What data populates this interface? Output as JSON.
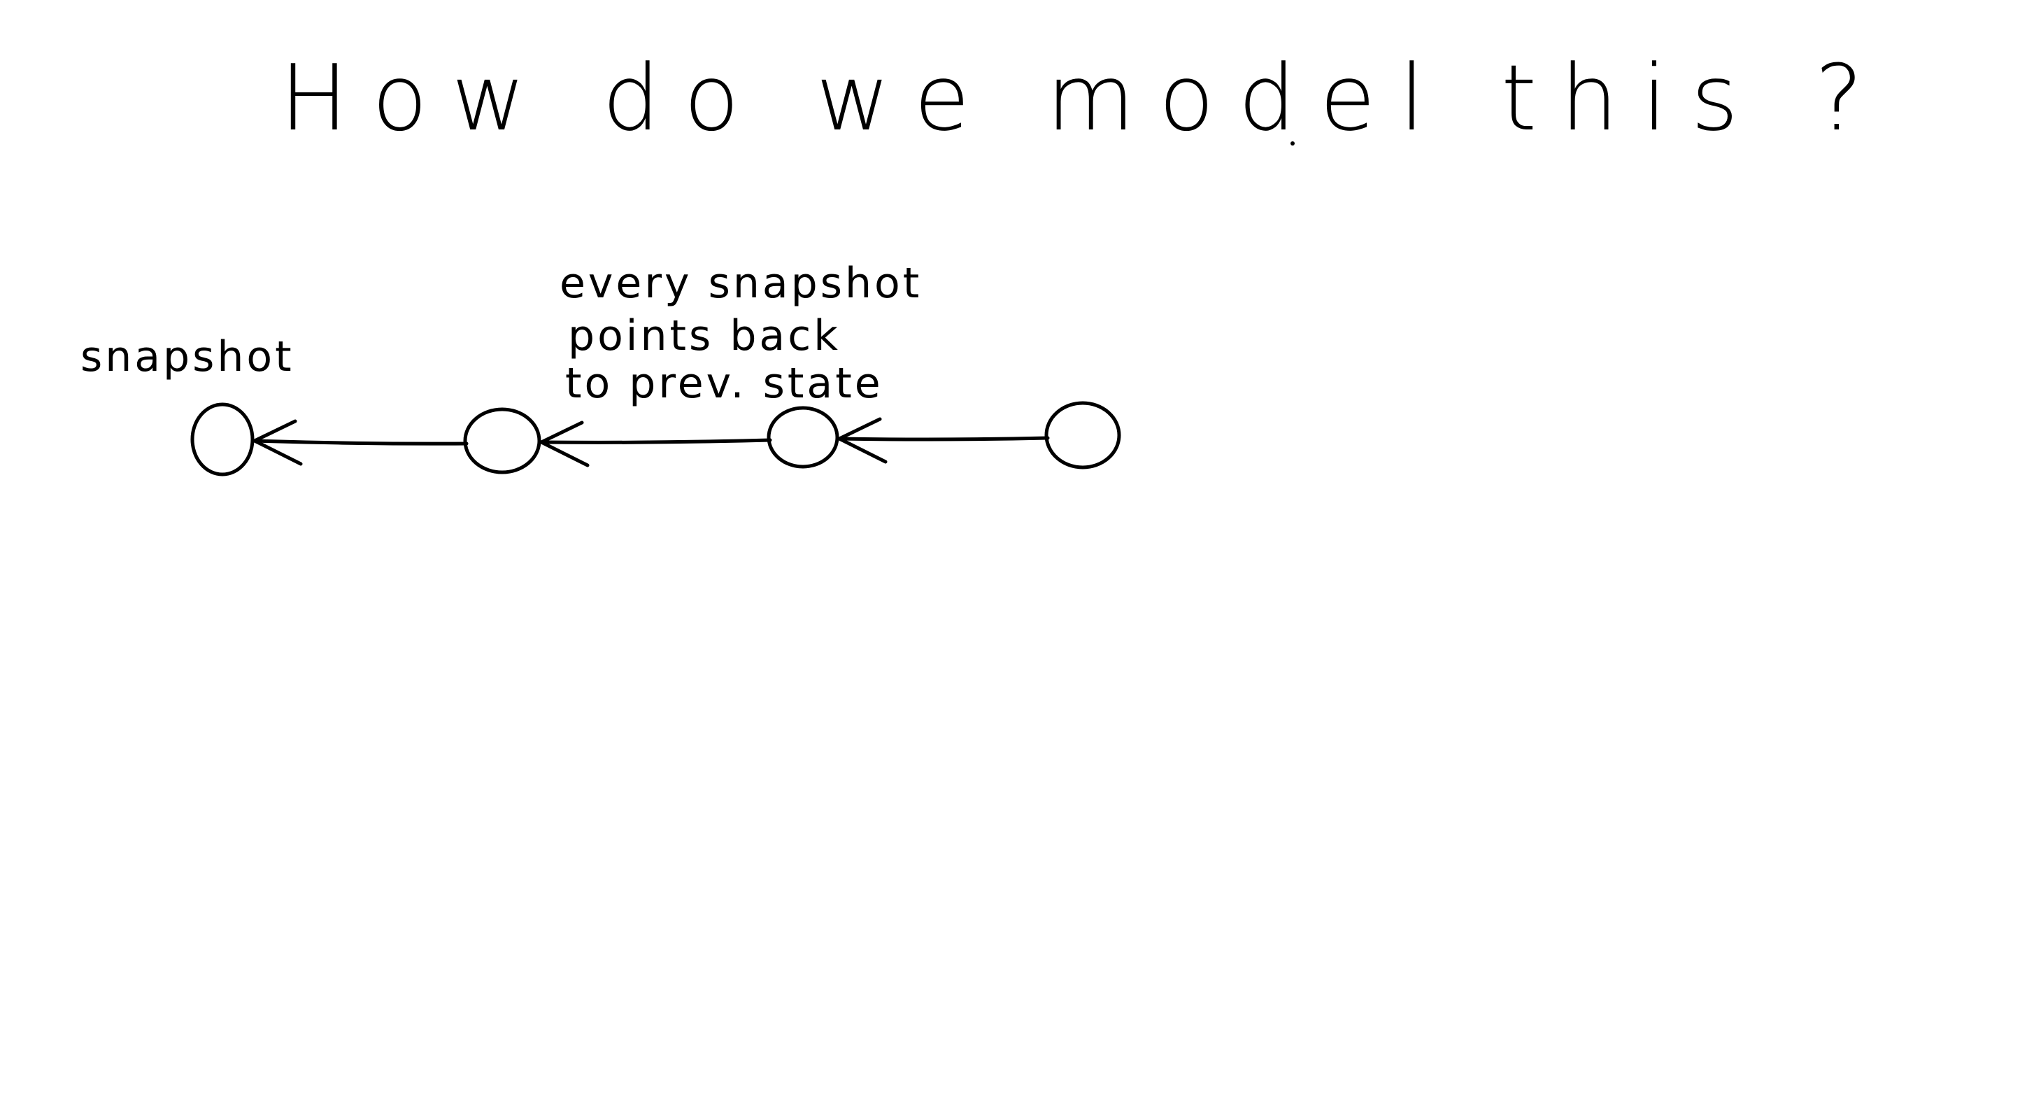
{
  "diagram": {
    "title": "How do we model this ?",
    "labels": {
      "first_node": "snapshot",
      "annotation_lines": [
        "every snapshot",
        "points back",
        "to prev. state"
      ]
    },
    "nodes": [
      {
        "id": "node-1"
      },
      {
        "id": "node-2"
      },
      {
        "id": "node-3"
      },
      {
        "id": "node-4"
      }
    ],
    "edges": [
      {
        "from": "node-2",
        "to": "node-1"
      },
      {
        "from": "node-3",
        "to": "node-2"
      },
      {
        "from": "node-4",
        "to": "node-3"
      }
    ],
    "colors": {
      "ink": "#000000",
      "background": "#ffffff"
    }
  }
}
